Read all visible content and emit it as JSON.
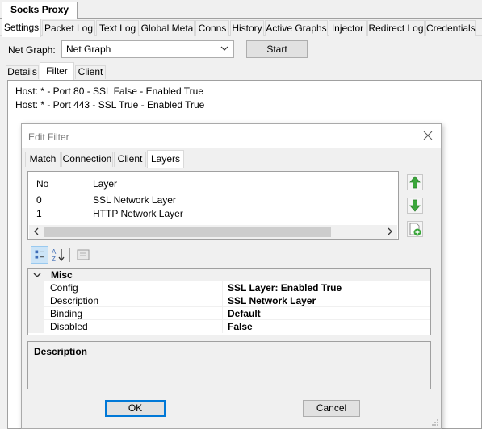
{
  "window": {
    "doc_tab": "Socks Proxy"
  },
  "main_tabs": [
    "Settings",
    "Packet Log",
    "Text Log",
    "Global Meta",
    "Conns",
    "History",
    "Active Graphs",
    "Injector",
    "Redirect Log",
    "Credentials"
  ],
  "toolbar": {
    "net_graph_label": "Net Graph:",
    "net_graph_value": "Net Graph",
    "start_label": "Start"
  },
  "sub_tabs": [
    "Details",
    "Filter",
    "Client"
  ],
  "filters": [
    "Host: * - Port 80 - SSL False - Enabled True",
    "Host: * - Port 443 - SSL True - Enabled True"
  ],
  "dialog": {
    "title": "Edit Filter",
    "tabs": [
      "Match",
      "Connection",
      "Client",
      "Layers"
    ],
    "layers": {
      "columns": [
        "No",
        "Layer"
      ],
      "rows": [
        {
          "no": "0",
          "layer": "SSL Network Layer"
        },
        {
          "no": "1",
          "layer": "HTTP Network Layer"
        }
      ]
    },
    "property_grid": {
      "category": "Misc",
      "properties": [
        {
          "name": "Config",
          "value": "SSL Layer: Enabled True"
        },
        {
          "name": "Description",
          "value": "SSL Network Layer"
        },
        {
          "name": "Binding",
          "value": "Default"
        },
        {
          "name": "Disabled",
          "value": "False"
        }
      ]
    },
    "description_label": "Description",
    "ok_label": "OK",
    "cancel_label": "Cancel"
  },
  "icons": {
    "move_up": "green-up-arrow-icon",
    "move_down": "green-down-arrow-icon",
    "add": "add-layer-icon",
    "categorized": "categorized-icon",
    "alphabetical": "alphabetical-sort-icon",
    "property_pages": "property-pages-icon",
    "close": "close-icon"
  },
  "colors": {
    "tab_active_bg": "#ffffff",
    "accent": "#0078d7",
    "arrow_green": "#3aa63a",
    "selected_tool": "#cce4f7"
  }
}
